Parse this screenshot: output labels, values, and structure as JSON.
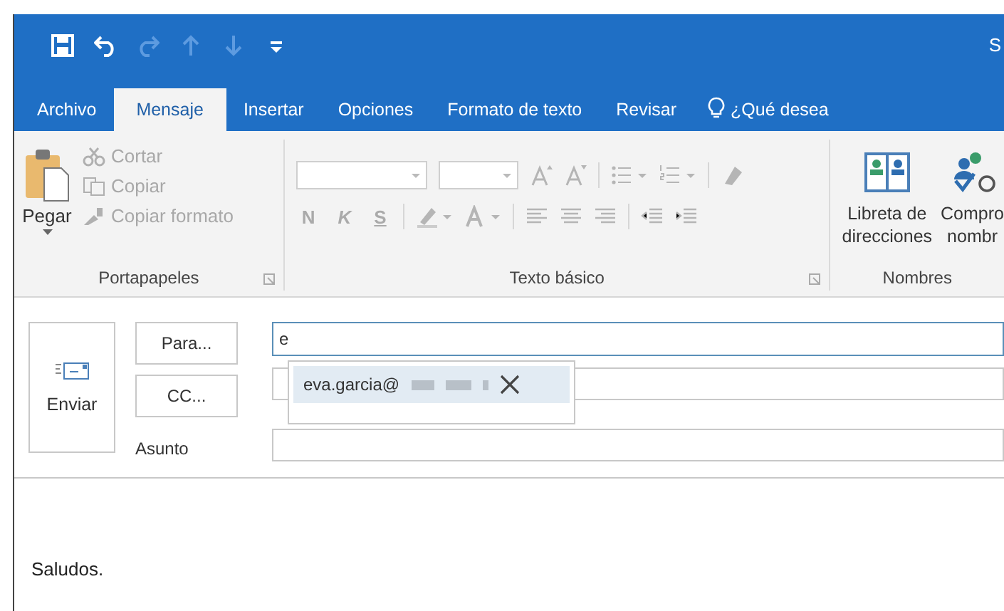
{
  "window": {
    "title": "S"
  },
  "quick_access": [
    {
      "kind": "save",
      "disabled": false
    },
    {
      "kind": "undo",
      "disabled": false
    },
    {
      "kind": "redo",
      "disabled": true
    },
    {
      "kind": "up",
      "disabled": true
    },
    {
      "kind": "down",
      "disabled": true
    },
    {
      "kind": "customize",
      "disabled": false
    }
  ],
  "tabs": [
    {
      "label": "Archivo",
      "selected": false
    },
    {
      "label": "Mensaje",
      "selected": true
    },
    {
      "label": "Insertar",
      "selected": false
    },
    {
      "label": "Opciones",
      "selected": false
    },
    {
      "label": "Formato de texto",
      "selected": false
    },
    {
      "label": "Revisar",
      "selected": false
    }
  ],
  "tell_me": "¿Qué desea",
  "clipboard": {
    "label": "Portapapeles",
    "paste": "Pegar",
    "items": [
      {
        "kind": "cut",
        "label": "Cortar",
        "disabled": true
      },
      {
        "kind": "copy",
        "label": "Copiar",
        "disabled": true
      },
      {
        "kind": "format",
        "label": "Copiar formato",
        "disabled": true
      }
    ]
  },
  "basic_text": {
    "label": "Texto básico",
    "format_buttons": [
      "N",
      "K",
      "S"
    ]
  },
  "names": {
    "label": "Nombres",
    "buttons": [
      {
        "kind": "book",
        "lines": [
          "Libreta de",
          "direcciones"
        ]
      },
      {
        "kind": "check",
        "lines": [
          "Compro",
          "nombr"
        ]
      }
    ]
  },
  "compose": {
    "send": "Enviar",
    "to_button": "Para...",
    "to_value": "e",
    "cc_button": "CC...",
    "subject_label": "Asunto",
    "suggestion": "eva.garcia@",
    "body": "Saludos."
  }
}
